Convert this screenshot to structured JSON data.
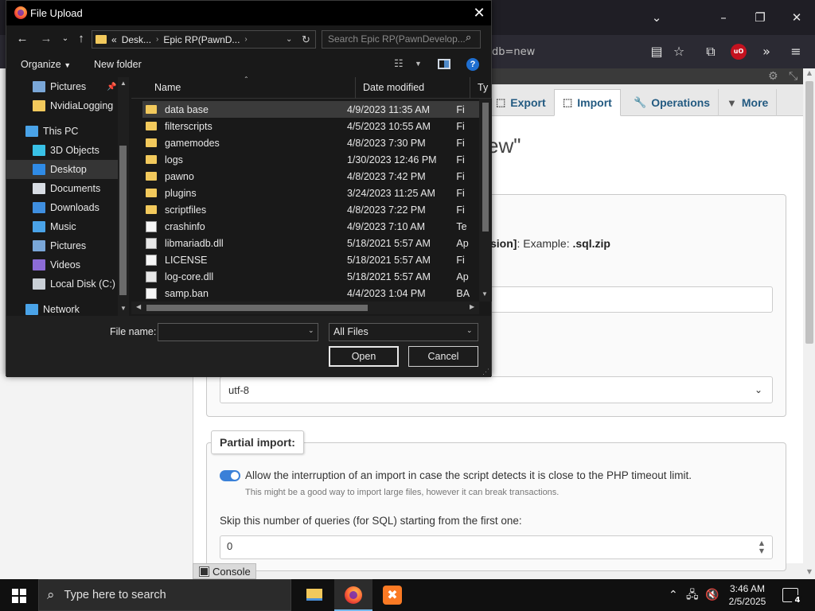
{
  "browser": {
    "url_fragment": "db=new",
    "icons": [
      "chevron-down-icon",
      "minimize-icon",
      "maximize-icon",
      "close-icon",
      "reader-view-icon",
      "bookmark-star-icon",
      "extensions-icon",
      "ublock-icon",
      "overflow-icon",
      "hamburger-menu-icon"
    ],
    "ublock_label": "uO"
  },
  "pma": {
    "tabs": [
      {
        "label": "Export",
        "icon": "export-icon"
      },
      {
        "label": "Import",
        "icon": "import-icon",
        "active": true
      },
      {
        "label": "Operations",
        "icon": "wrench-icon"
      },
      {
        "label": "More",
        "icon": "chevron-down-icon"
      }
    ],
    "heading_fragment": "ew\"",
    "example_line": {
      "prefix": "sion]",
      "text": ": Example: ",
      "bold": ".sql.zip"
    },
    "charset_value": "utf-8",
    "partial_import": {
      "legend": "Partial import:",
      "toggle_on": true,
      "allow_label": "Allow the interruption of an import in case the script detects it is close to the PHP timeout limit.",
      "allow_hint": "This might be a good way to import large files, however it can break transactions.",
      "skip_label": "Skip this number of queries (for SQL) starting from the first one:",
      "skip_value": "0"
    },
    "console_label": "Console"
  },
  "dialog": {
    "title": "File Upload",
    "address": {
      "overflow": "«",
      "segments": [
        "Desk...",
        "Epic RP(PawnD..."
      ]
    },
    "search_placeholder": "Search Epic RP(PawnDevelop...",
    "organize_label": "Organize",
    "new_folder_label": "New folder",
    "nav_items": [
      {
        "label": "Pictures",
        "icon": "pictures-icon",
        "indent": 1,
        "pinned": true
      },
      {
        "label": "NvidiaLogging",
        "icon": "folder-icon",
        "indent": 1
      },
      {
        "label": "This PC",
        "icon": "this-pc-icon",
        "indent": 0
      },
      {
        "label": "3D Objects",
        "icon": "3d-objects-icon",
        "indent": 1
      },
      {
        "label": "Desktop",
        "icon": "desktop-icon",
        "indent": 1,
        "selected": true
      },
      {
        "label": "Documents",
        "icon": "documents-icon",
        "indent": 1
      },
      {
        "label": "Downloads",
        "icon": "downloads-icon",
        "indent": 1
      },
      {
        "label": "Music",
        "icon": "music-icon",
        "indent": 1
      },
      {
        "label": "Pictures",
        "icon": "pictures-icon",
        "indent": 1
      },
      {
        "label": "Videos",
        "icon": "videos-icon",
        "indent": 1
      },
      {
        "label": "Local Disk (C:)",
        "icon": "local-disk-icon",
        "indent": 1
      },
      {
        "label": "Network",
        "icon": "network-icon",
        "indent": 0
      }
    ],
    "columns": [
      "Name",
      "Date modified",
      "Ty"
    ],
    "files": [
      {
        "name": "data base",
        "date": "4/9/2023 11:35 AM",
        "type": "Fi",
        "kind": "folder",
        "selected": true
      },
      {
        "name": "filterscripts",
        "date": "4/5/2023 10:55 AM",
        "type": "Fi",
        "kind": "folder"
      },
      {
        "name": "gamemodes",
        "date": "4/8/2023 7:30 PM",
        "type": "Fi",
        "kind": "folder"
      },
      {
        "name": "logs",
        "date": "1/30/2023 12:46 PM",
        "type": "Fi",
        "kind": "folder"
      },
      {
        "name": "pawno",
        "date": "4/8/2023 7:42 PM",
        "type": "Fi",
        "kind": "folder"
      },
      {
        "name": "plugins",
        "date": "3/24/2023 11:25 AM",
        "type": "Fi",
        "kind": "folder"
      },
      {
        "name": "scriptfiles",
        "date": "4/8/2023 7:22 PM",
        "type": "Fi",
        "kind": "folder"
      },
      {
        "name": "crashinfo",
        "date": "4/9/2023 7:10 AM",
        "type": "Te",
        "kind": "doc"
      },
      {
        "name": "libmariadb.dll",
        "date": "5/18/2021 5:57 AM",
        "type": "Ap",
        "kind": "dll"
      },
      {
        "name": "LICENSE",
        "date": "5/18/2021 5:57 AM",
        "type": "Fi",
        "kind": "doc"
      },
      {
        "name": "log-core.dll",
        "date": "5/18/2021 5:57 AM",
        "type": "Ap",
        "kind": "dll"
      },
      {
        "name": "samp.ban",
        "date": "4/4/2023 1:04 PM",
        "type": "BA",
        "kind": "doc"
      }
    ],
    "file_name_label": "File name:",
    "file_name_value": "",
    "filter_value": "All Files",
    "open_label": "Open",
    "cancel_label": "Cancel",
    "help_label": "?"
  },
  "taskbar": {
    "search_placeholder": "Type here to search",
    "apps": [
      {
        "name": "file-explorer",
        "active": false
      },
      {
        "name": "firefox",
        "active": true
      },
      {
        "name": "xampp",
        "active": false
      }
    ],
    "xampp_glyph": "✖",
    "time": "3:46 AM",
    "date": "2/5/2025",
    "notification_count": "4"
  }
}
